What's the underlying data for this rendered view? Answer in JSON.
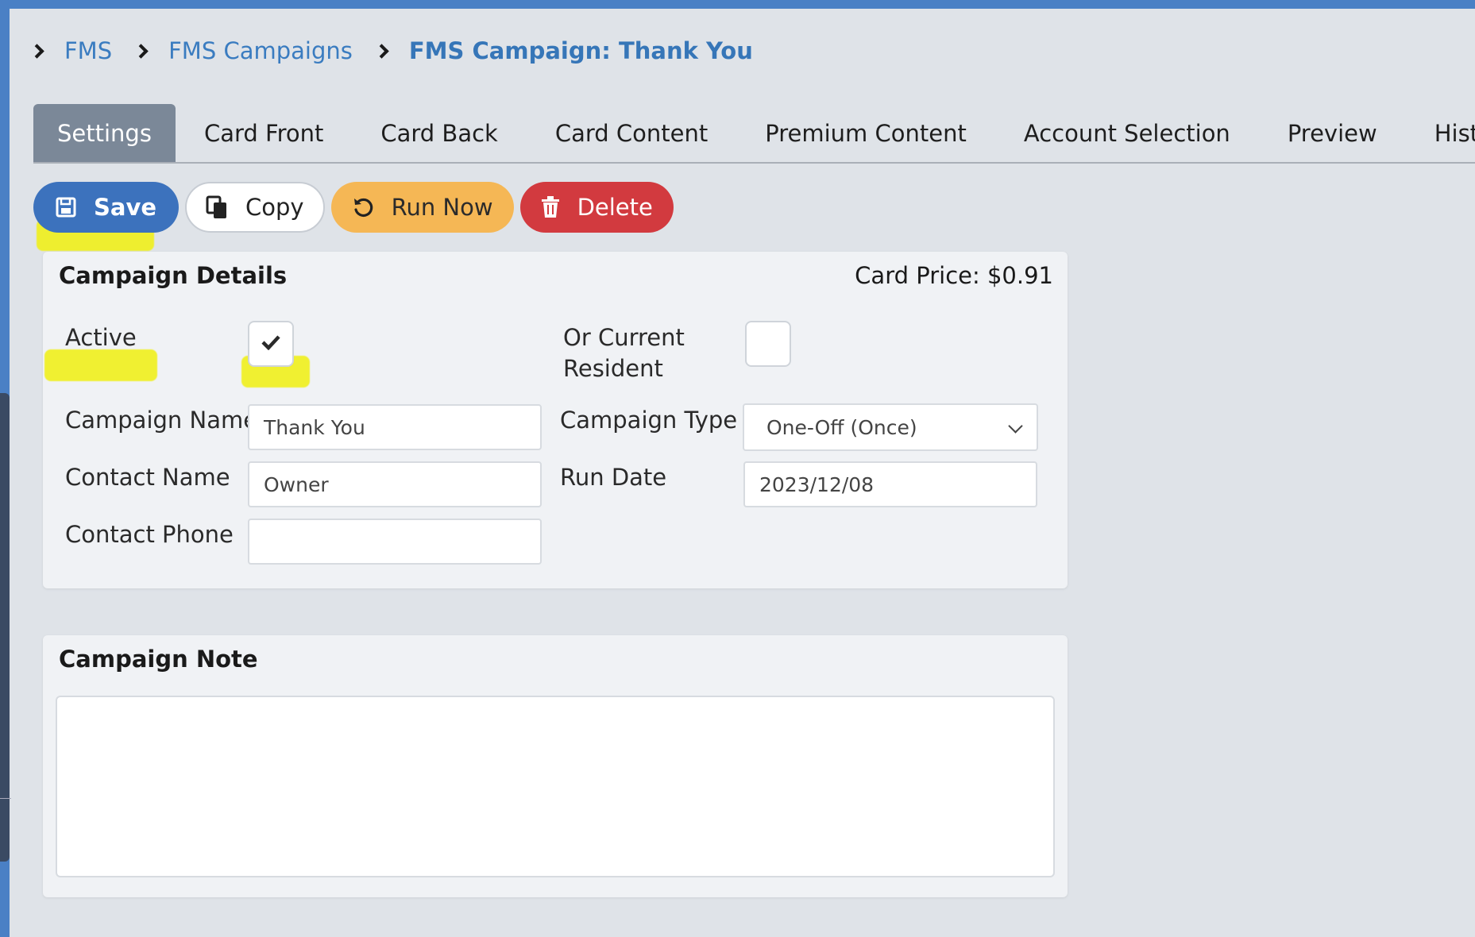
{
  "breadcrumb": {
    "items": [
      "FMS",
      "FMS Campaigns",
      "FMS Campaign: Thank You"
    ]
  },
  "tabs": [
    {
      "label": "Settings",
      "active": true
    },
    {
      "label": "Card Front"
    },
    {
      "label": "Card Back"
    },
    {
      "label": "Card Content"
    },
    {
      "label": "Premium Content"
    },
    {
      "label": "Account Selection"
    },
    {
      "label": "Preview"
    },
    {
      "label": "History"
    }
  ],
  "toolbar": {
    "save_label": "Save",
    "copy_label": "Copy",
    "run_now_label": "Run Now",
    "delete_label": "Delete"
  },
  "campaign_details": {
    "title": "Campaign Details",
    "card_price": "Card Price: $0.91",
    "active_label": "Active",
    "active_checked": true,
    "or_current_resident_label_line1": "Or Current",
    "or_current_resident_label_line2": "Resident",
    "or_current_resident_checked": false,
    "campaign_name_label": "Campaign Name",
    "campaign_name_value": "Thank You",
    "campaign_type_label": "Campaign Type",
    "campaign_type_value": "One-Off (Once)",
    "contact_name_label": "Contact Name",
    "contact_name_value": "Owner",
    "run_date_label": "Run Date",
    "run_date_value": "2023/12/08",
    "contact_phone_label": "Contact Phone",
    "contact_phone_value": ""
  },
  "campaign_note": {
    "title": "Campaign Note",
    "value": ""
  },
  "colors": {
    "top_bar": "#4a80c5",
    "save_button": "#3c72bd",
    "run_now_button": "#f5b755",
    "delete_button": "#d23a3f",
    "active_tab": "#7b8898",
    "highlight": "#f0f01c",
    "breadcrumb_link": "#3a7cc0"
  }
}
